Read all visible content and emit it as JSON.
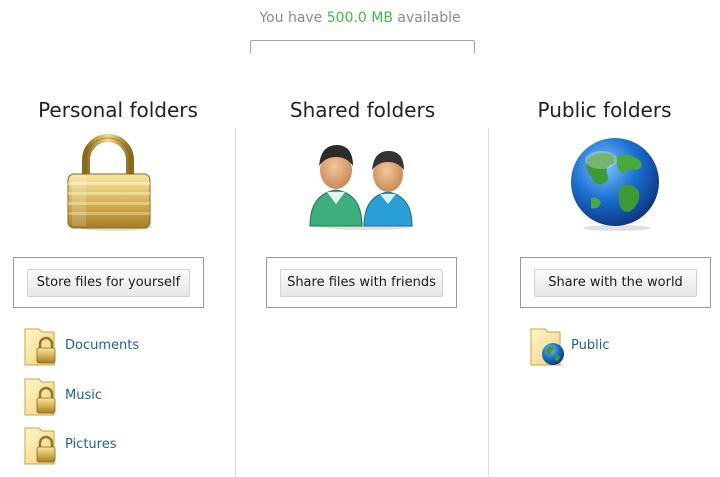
{
  "storage": {
    "prefix": "You have",
    "amount": "500.0 MB",
    "suffix": "available",
    "used_fraction": 0.0,
    "accent_color": "#3fbf3f"
  },
  "columns": {
    "personal": {
      "title": "Personal folders",
      "icon": "padlock-icon",
      "button": "Store files for yourself",
      "folders": [
        {
          "label": "Documents",
          "icon": "locked-folder-icon"
        },
        {
          "label": "Music",
          "icon": "locked-folder-icon"
        },
        {
          "label": "Pictures",
          "icon": "locked-folder-icon"
        }
      ]
    },
    "shared": {
      "title": "Shared folders",
      "icon": "users-icon",
      "button": "Share files with friends",
      "folders": []
    },
    "public": {
      "title": "Public folders",
      "icon": "globe-icon",
      "button": "Share with the world",
      "folders": [
        {
          "label": "Public",
          "icon": "globe-folder-icon"
        }
      ]
    }
  },
  "colors": {
    "link": "#1d5fa8",
    "title": "#222222",
    "muted": "#8a8a8a"
  }
}
